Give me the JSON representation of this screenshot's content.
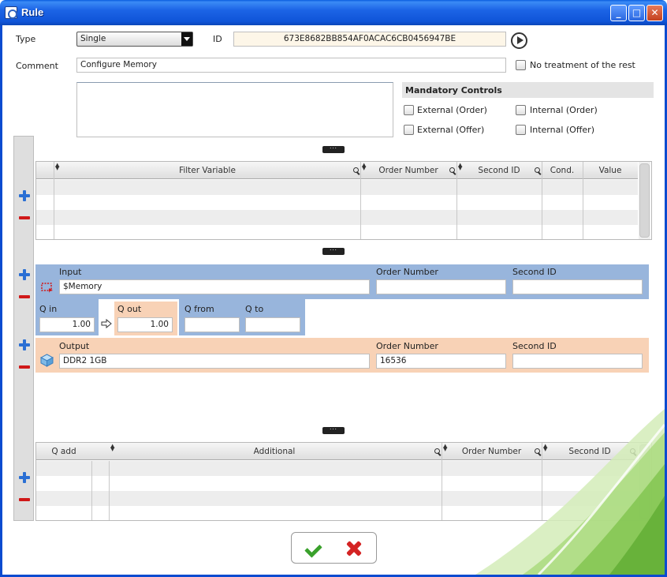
{
  "window": {
    "title": "Rule"
  },
  "header": {
    "type_label": "Type",
    "type_value": "Single",
    "id_label": "ID",
    "id_value": "673E8682BB854AF0ACAC6CB0456947BE",
    "comment_label": "Comment",
    "comment_value": "Configure Memory",
    "no_treatment_label": "No treatment of the rest"
  },
  "mandatory": {
    "title": "Mandatory Controls",
    "external_order": "External (Order)",
    "internal_order": "Internal (Order)",
    "external_offer": "External (Offer)",
    "internal_offer": "Internal (Offer)"
  },
  "filter_table": {
    "columns": [
      "Filter Variable",
      "Order Number",
      "Second ID",
      "Cond.",
      "Value"
    ]
  },
  "input": {
    "input_label": "Input",
    "input_value": "$Memory",
    "order_label": "Order Number",
    "order_value": "",
    "second_label": "Second ID",
    "second_value": ""
  },
  "quantities": {
    "qin_label": "Q in",
    "qin_value": "1.00",
    "qout_label": "Q out",
    "qout_value": "1.00",
    "qfrom_label": "Q from",
    "qfrom_value": "",
    "qto_label": "Q to",
    "qto_value": ""
  },
  "output": {
    "output_label": "Output",
    "output_value": "DDR2 1GB",
    "order_label": "Order Number",
    "order_value": "16536",
    "second_label": "Second ID",
    "second_value": ""
  },
  "additional_table": {
    "columns": [
      "Q add",
      "Additional",
      "Order Number",
      "Second ID"
    ]
  },
  "colors": {
    "input_panel": "#98b5dc",
    "output_panel": "#f8d2b6",
    "ok": "#3aa12c",
    "cancel": "#d42323"
  }
}
